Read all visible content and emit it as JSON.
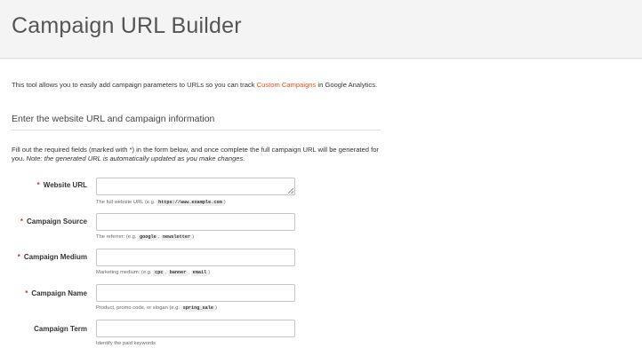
{
  "page": {
    "title": "Campaign URL Builder"
  },
  "intro": {
    "text_before": "This tool allows you to easily add campaign parameters to URLs so you can track ",
    "link": "Custom Campaigns",
    "text_after": " in Google Analytics."
  },
  "section": {
    "heading": "Enter the website URL and campaign information"
  },
  "instructions": {
    "text": "Fill out the required fields (marked with *) in the form below, and once complete the full campaign URL will be generated for you. ",
    "note": "Note: the generated URL is automatically updated as you make changes."
  },
  "fields": [
    {
      "label": "Website URL",
      "required": "*",
      "value": "",
      "help_before": "The full website URL (e.g. ",
      "examples": [
        "https://www.example.com"
      ],
      "help_after": ")"
    },
    {
      "label": "Campaign Source",
      "required": "*",
      "value": "",
      "help_before": "The referrer: (e.g. ",
      "examples": [
        "google",
        "newsletter"
      ],
      "help_after": ")"
    },
    {
      "label": "Campaign Medium",
      "required": "*",
      "value": "",
      "help_before": "Marketing medium: (e.g. ",
      "examples": [
        "cpc",
        "banner",
        "email"
      ],
      "help_after": ")"
    },
    {
      "label": "Campaign Name",
      "required": "*",
      "value": "",
      "help_before": "Product, promo code, or slogan (e.g. ",
      "examples": [
        "spring_sale"
      ],
      "help_after": ")"
    },
    {
      "label": "Campaign Term",
      "required": "",
      "value": "",
      "help_before": "Identify the paid keywords",
      "examples": [],
      "help_after": ""
    }
  ],
  "colors": {
    "link": "#e8501e",
    "required": "#d9302c",
    "header_bg": "#f4f4f4"
  }
}
